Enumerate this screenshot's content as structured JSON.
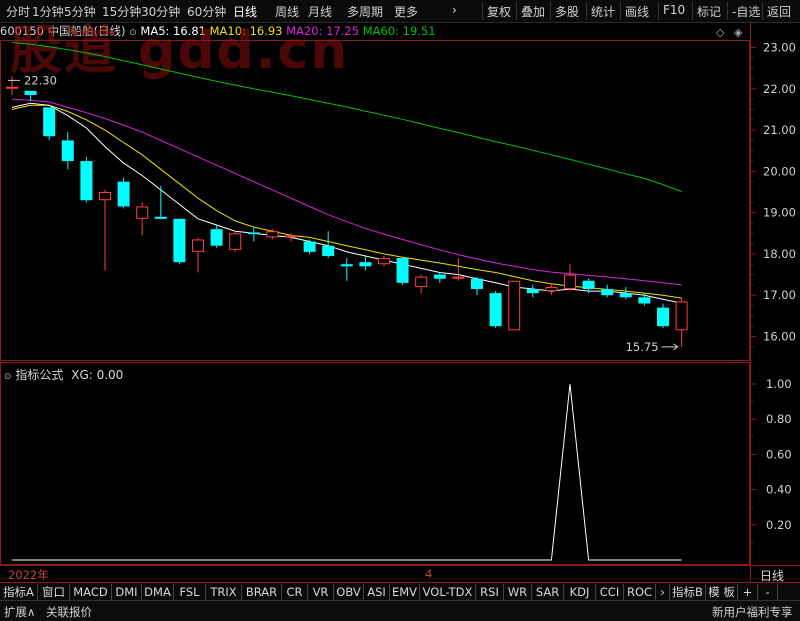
{
  "toolbar": {
    "left_items": [
      "分时",
      "1分钟",
      "5分钟",
      "15分钟",
      "30分钟",
      "60分钟",
      "日线",
      "周线",
      "月线",
      "多周期",
      "更多"
    ],
    "more_arrow": "›",
    "right_items": [
      "复权",
      "叠加",
      "多股",
      "统计",
      "画线",
      "F10",
      "标记",
      "-自选",
      "返回"
    ]
  },
  "header": {
    "code": "600150",
    "name": "中国船舶(日线)",
    "ma5": "MA5: 16.81",
    "ma10": "MA10: 16.93",
    "ma20": "MA20: 17.25",
    "ma60": "MA60: 19.51",
    "watermark": "股道 gdd.cn"
  },
  "indicator_header": {
    "title": "指标公式",
    "value": "XG: 0.00"
  },
  "colors": {
    "up": "#ff4040",
    "down": "#00ffff",
    "ma5": "#ffffff",
    "ma10": "#f0e000",
    "ma20": "#e020e0",
    "ma60": "#00c000",
    "frame": "#8b1a1a",
    "watermark": "#8a1010"
  },
  "chart_data": [
    {
      "type": "candlestick",
      "y_axis": {
        "ticks": [
          "23.00",
          "22.00",
          "21.00",
          "20.00",
          "19.00",
          "18.00",
          "17.00",
          "16.00"
        ],
        "ylim": [
          15.6,
          23.3
        ]
      },
      "annotations": {
        "high_label": "22.30",
        "low_label": "15.75"
      },
      "candles": [
        {
          "o": 22.05,
          "c": 22.05,
          "h": 22.3,
          "l": 21.85,
          "dir": "up"
        },
        {
          "o": 21.95,
          "c": 21.85,
          "h": 21.95,
          "l": 21.7,
          "dir": "down"
        },
        {
          "o": 21.55,
          "c": 20.85,
          "h": 21.55,
          "l": 20.75,
          "dir": "down"
        },
        {
          "o": 20.75,
          "c": 20.25,
          "h": 20.95,
          "l": 20.05,
          "dir": "down"
        },
        {
          "o": 20.25,
          "c": 19.3,
          "h": 20.35,
          "l": 19.25,
          "dir": "down"
        },
        {
          "o": 19.3,
          "c": 19.5,
          "h": 19.55,
          "l": 17.6,
          "dir": "up"
        },
        {
          "o": 19.75,
          "c": 19.15,
          "h": 19.85,
          "l": 19.1,
          "dir": "down"
        },
        {
          "o": 18.85,
          "c": 19.15,
          "h": 19.25,
          "l": 18.45,
          "dir": "up"
        },
        {
          "o": 18.9,
          "c": 18.85,
          "h": 19.65,
          "l": 18.85,
          "dir": "down"
        },
        {
          "o": 18.85,
          "c": 17.8,
          "h": 18.85,
          "l": 17.75,
          "dir": "down"
        },
        {
          "o": 18.05,
          "c": 18.35,
          "h": 18.4,
          "l": 17.55,
          "dir": "up"
        },
        {
          "o": 18.6,
          "c": 18.2,
          "h": 18.7,
          "l": 18.15,
          "dir": "down"
        },
        {
          "o": 18.1,
          "c": 18.5,
          "h": 18.55,
          "l": 18.05,
          "dir": "up"
        },
        {
          "o": 18.52,
          "c": 18.48,
          "h": 18.65,
          "l": 18.3,
          "dir": "down"
        },
        {
          "o": 18.4,
          "c": 18.55,
          "h": 18.6,
          "l": 18.35,
          "dir": "up"
        },
        {
          "o": 18.45,
          "c": 18.4,
          "h": 18.5,
          "l": 18.3,
          "dir": "up"
        },
        {
          "o": 18.3,
          "c": 18.05,
          "h": 18.35,
          "l": 18.0,
          "dir": "down"
        },
        {
          "o": 18.2,
          "c": 17.95,
          "h": 18.55,
          "l": 17.9,
          "dir": "down"
        },
        {
          "o": 17.75,
          "c": 17.7,
          "h": 17.9,
          "l": 17.35,
          "dir": "down"
        },
        {
          "o": 17.8,
          "c": 17.7,
          "h": 17.95,
          "l": 17.6,
          "dir": "down"
        },
        {
          "o": 17.75,
          "c": 17.9,
          "h": 17.95,
          "l": 17.7,
          "dir": "up"
        },
        {
          "o": 17.9,
          "c": 17.3,
          "h": 17.9,
          "l": 17.25,
          "dir": "down"
        },
        {
          "o": 17.2,
          "c": 17.45,
          "h": 17.5,
          "l": 17.05,
          "dir": "up"
        },
        {
          "o": 17.5,
          "c": 17.4,
          "h": 17.55,
          "l": 17.3,
          "dir": "down"
        },
        {
          "o": 17.4,
          "c": 17.45,
          "h": 17.9,
          "l": 17.35,
          "dir": "up"
        },
        {
          "o": 17.4,
          "c": 17.15,
          "h": 17.45,
          "l": 17.0,
          "dir": "down"
        },
        {
          "o": 17.05,
          "c": 16.25,
          "h": 17.1,
          "l": 16.2,
          "dir": "down"
        },
        {
          "o": 16.15,
          "c": 17.35,
          "h": 17.35,
          "l": 16.15,
          "dir": "up"
        },
        {
          "o": 17.15,
          "c": 17.05,
          "h": 17.25,
          "l": 16.95,
          "dir": "down"
        },
        {
          "o": 17.1,
          "c": 17.2,
          "h": 17.3,
          "l": 17.0,
          "dir": "up"
        },
        {
          "o": 17.15,
          "c": 17.5,
          "h": 17.75,
          "l": 17.1,
          "dir": "up"
        },
        {
          "o": 17.35,
          "c": 17.15,
          "h": 17.4,
          "l": 17.05,
          "dir": "down"
        },
        {
          "o": 17.15,
          "c": 17.0,
          "h": 17.25,
          "l": 16.95,
          "dir": "down"
        },
        {
          "o": 17.05,
          "c": 16.95,
          "h": 17.2,
          "l": 16.9,
          "dir": "down"
        },
        {
          "o": 16.95,
          "c": 16.8,
          "h": 17.05,
          "l": 16.75,
          "dir": "down"
        },
        {
          "o": 16.7,
          "c": 16.25,
          "h": 16.8,
          "l": 16.2,
          "dir": "down"
        },
        {
          "o": 16.15,
          "c": 16.85,
          "h": 16.95,
          "l": 15.75,
          "dir": "up"
        }
      ],
      "series": [
        {
          "name": "MA5",
          "values": [
            21.55,
            21.65,
            21.6,
            21.35,
            21.05,
            20.6,
            20.2,
            19.9,
            19.55,
            19.2,
            18.85,
            18.7,
            18.55,
            18.5,
            18.45,
            18.4,
            18.3,
            18.2,
            18.05,
            17.95,
            17.85,
            17.75,
            17.65,
            17.55,
            17.5,
            17.4,
            17.3,
            17.2,
            17.15,
            17.1,
            17.15,
            17.1,
            17.1,
            17.05,
            17.0,
            16.9,
            16.81
          ]
        },
        {
          "name": "MA10",
          "values": [
            21.5,
            21.6,
            21.6,
            21.45,
            21.25,
            21.0,
            20.7,
            20.4,
            20.05,
            19.7,
            19.35,
            19.05,
            18.8,
            18.65,
            18.55,
            18.45,
            18.4,
            18.3,
            18.2,
            18.1,
            18.0,
            17.92,
            17.85,
            17.78,
            17.7,
            17.62,
            17.55,
            17.45,
            17.35,
            17.28,
            17.22,
            17.18,
            17.14,
            17.1,
            17.05,
            17.0,
            16.93
          ]
        },
        {
          "name": "MA20",
          "values": [
            21.75,
            21.72,
            21.68,
            21.55,
            21.42,
            21.28,
            21.12,
            20.95,
            20.75,
            20.55,
            20.35,
            20.15,
            19.95,
            19.75,
            19.55,
            19.35,
            19.15,
            18.95,
            18.78,
            18.62,
            18.48,
            18.35,
            18.22,
            18.1,
            17.98,
            17.88,
            17.78,
            17.7,
            17.62,
            17.56,
            17.52,
            17.48,
            17.44,
            17.4,
            17.35,
            17.3,
            17.25
          ]
        },
        {
          "name": "MA60",
          "values": [
            23.12,
            23.08,
            23.02,
            22.95,
            22.87,
            22.78,
            22.68,
            22.58,
            22.48,
            22.38,
            22.28,
            22.18,
            22.09,
            22.0,
            21.92,
            21.83,
            21.74,
            21.65,
            21.56,
            21.46,
            21.36,
            21.26,
            21.15,
            21.04,
            20.94,
            20.83,
            20.72,
            20.62,
            20.51,
            20.4,
            20.29,
            20.17,
            20.06,
            19.94,
            19.83,
            19.68,
            19.51
          ]
        }
      ]
    },
    {
      "type": "line",
      "name": "XG",
      "y_axis": {
        "ticks": [
          "1.00",
          "0.80",
          "0.60",
          "0.40",
          "0.20"
        ],
        "ylim": [
          0,
          1.05
        ]
      },
      "values": [
        0,
        0,
        0,
        0,
        0,
        0,
        0,
        0,
        0,
        0,
        0,
        0,
        0,
        0,
        0,
        0,
        0,
        0,
        0,
        0,
        0,
        0,
        0,
        0,
        0,
        0,
        0,
        0,
        0,
        0,
        1,
        0,
        0,
        0,
        0,
        0,
        0
      ]
    }
  ],
  "x_axis": {
    "start_label": "2022年",
    "month_label": "4",
    "period_label": "日线"
  },
  "indicator_tabs": [
    "指标A",
    "窗口",
    "MACD",
    "DMI",
    "DMA",
    "FSL",
    "TRIX",
    "BRAR",
    "CR",
    "VR",
    "OBV",
    "ASI",
    "EMV",
    "VOL-TDX",
    "RSI",
    "WR",
    "SAR",
    "KDJ",
    "CCI",
    "ROC",
    "›",
    "指标B",
    "模 板",
    "+",
    "-"
  ],
  "status": {
    "left1": "扩展∧",
    "left2": "关联报价",
    "right": "新用户福利专享"
  }
}
